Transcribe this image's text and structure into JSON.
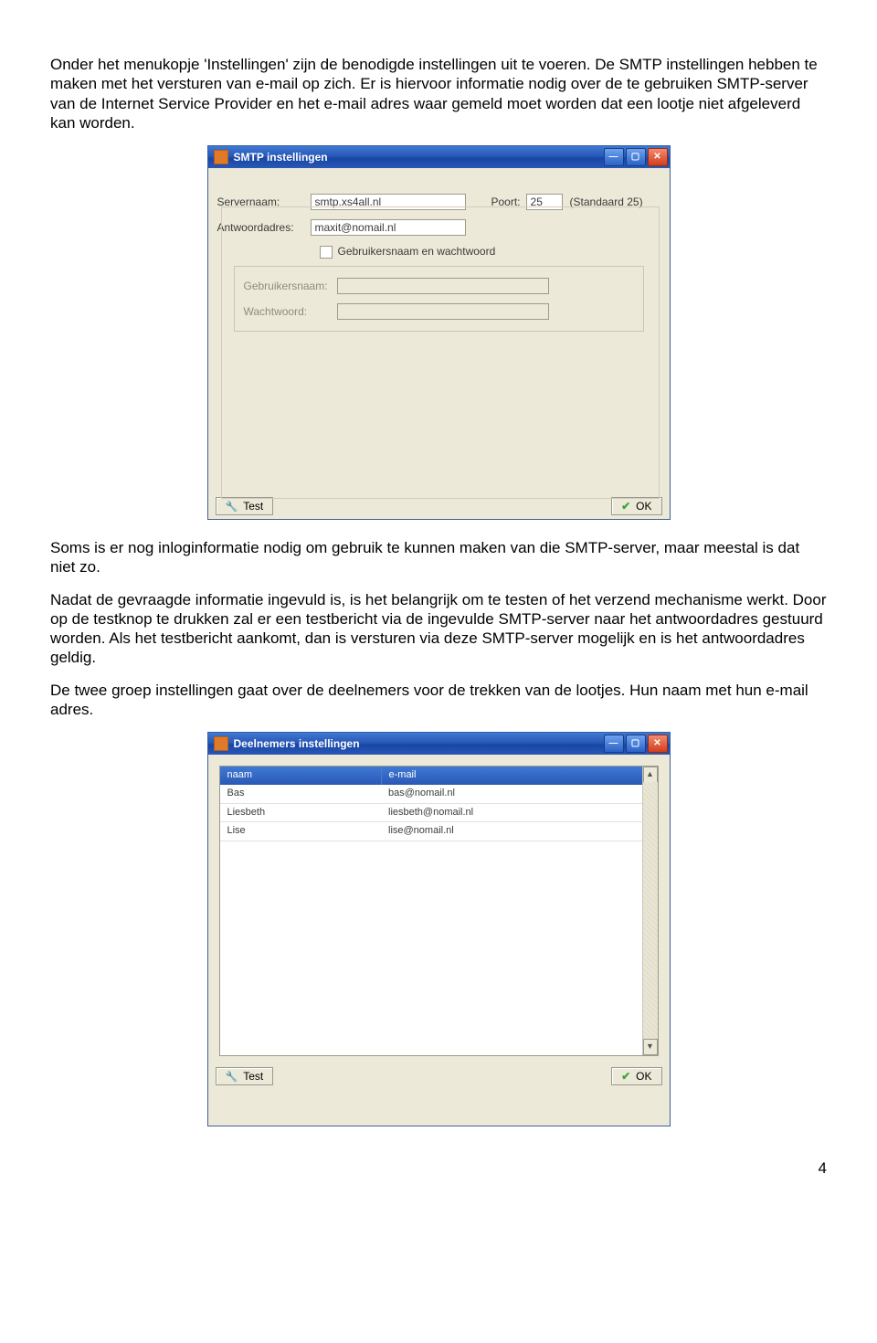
{
  "para": {
    "p1": "Onder het menukopje 'Instellingen' zijn de benodigde instellingen uit te voeren. De SMTP instellingen hebben te maken met het versturen van e-mail op zich. Er is hiervoor informatie nodig over de te gebruiken SMTP-server van de Internet Service Provider en het e-mail adres waar gemeld moet worden dat een lootje niet afgeleverd kan worden.",
    "p2": "Soms is er nog inloginformatie nodig om gebruik te kunnen maken van die SMTP-server, maar meestal is dat niet zo.",
    "p3": "Nadat de gevraagde informatie ingevuld is, is het belangrijk om te testen of het verzend mechanisme werkt. Door op de testknop te drukken zal er een testbericht via de ingevulde SMTP-server naar het antwoordadres gestuurd worden. Als het testbericht aankomt, dan is versturen via deze SMTP-server mogelijk en is het antwoordadres geldig.",
    "p4": "De twee groep instellingen gaat over de deelnemers voor de trekken van de lootjes. Hun naam met hun e-mail adres."
  },
  "page_number": "4",
  "smtp": {
    "title": "SMTP instellingen",
    "labels": {
      "servernaam": "Servernaam:",
      "poort": "Poort:",
      "poort_note": "(Standaard 25)",
      "antwoord": "Antwoordadres:",
      "auth_check": "Gebruikersnaam en wachtwoord",
      "gebruikersnaam": "Gebruikersnaam:",
      "wachtwoord": "Wachtwoord:"
    },
    "values": {
      "servernaam": "smtp.xs4all.nl",
      "poort": "25",
      "antwoord": "maxit@nomail.nl",
      "gebruikersnaam": "",
      "wachtwoord": ""
    },
    "buttons": {
      "test": "Test",
      "ok": "OK"
    }
  },
  "deelnemers": {
    "title": "Deelnemers instellingen",
    "headers": {
      "naam": "naam",
      "email": "e-mail"
    },
    "rows": [
      {
        "naam": "Bas",
        "email": "bas@nomail.nl"
      },
      {
        "naam": "Liesbeth",
        "email": "liesbeth@nomail.nl"
      },
      {
        "naam": "Lise",
        "email": "lise@nomail.nl"
      }
    ],
    "buttons": {
      "test": "Test",
      "ok": "OK"
    }
  }
}
